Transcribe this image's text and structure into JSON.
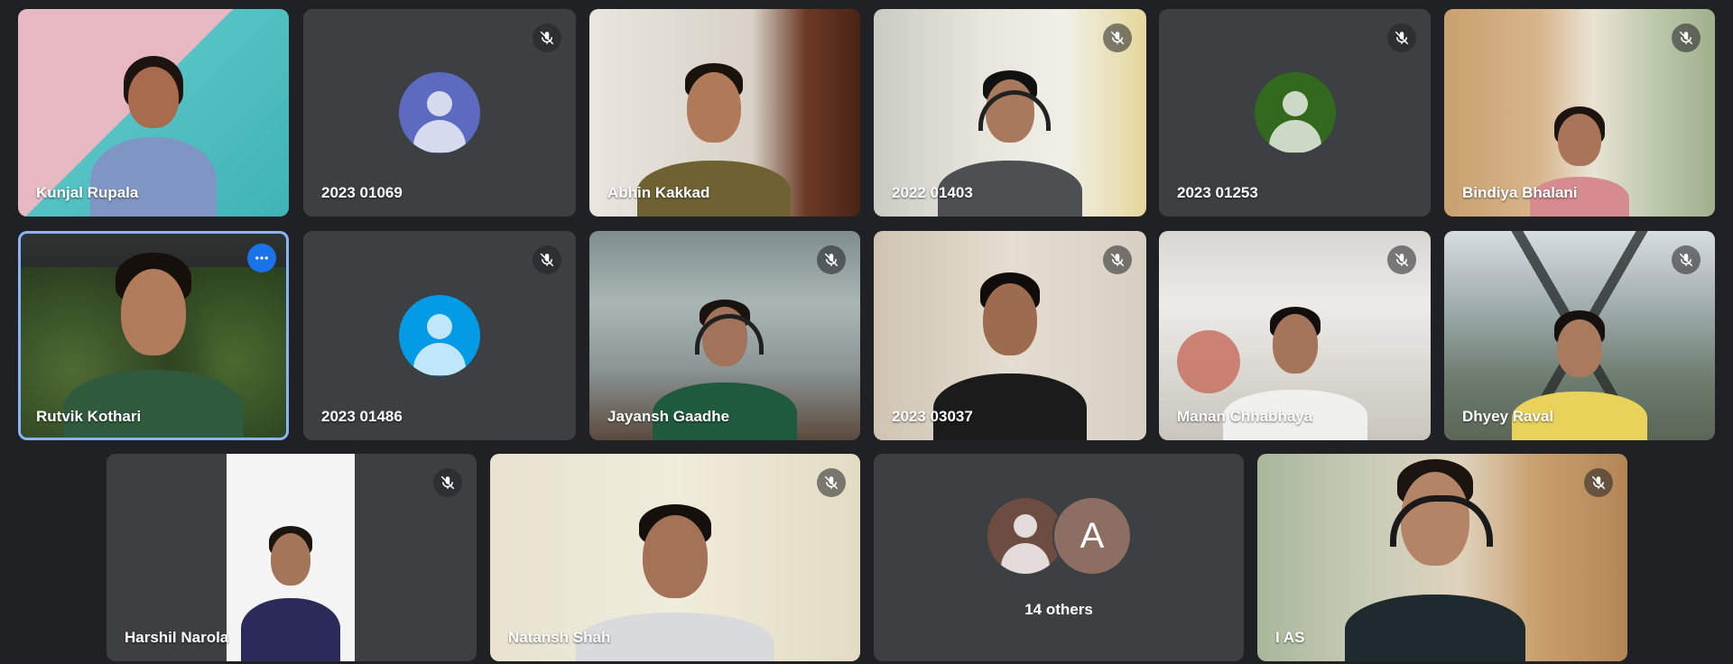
{
  "participants": {
    "t1": {
      "name": "Kunjal Rupala",
      "muted": false
    },
    "t2": {
      "name": "2023 01069",
      "muted": true,
      "avatar_color": "#5c6bc0"
    },
    "t3": {
      "name": "Abhin Kakkad",
      "muted": false
    },
    "t4": {
      "name": "2022 01403",
      "muted": true
    },
    "t5": {
      "name": "2023 01253",
      "muted": true,
      "avatar_color": "#33691e"
    },
    "t6": {
      "name": "Bindiya Bhalani",
      "muted": true
    },
    "t7": {
      "name": "Rutvik Kothari",
      "muted": false,
      "active_speaker": true
    },
    "t8": {
      "name": "2023 01486",
      "muted": true,
      "avatar_color": "#039be5"
    },
    "t9": {
      "name": "Jayansh Gaadhe",
      "muted": true
    },
    "t10": {
      "name": "2023 03037",
      "muted": true
    },
    "t11": {
      "name": "Manan Chhabhaya",
      "muted": true
    },
    "t12": {
      "name": "Dhyey Raval",
      "muted": true
    },
    "t13": {
      "name": "Harshil Narola",
      "muted": true
    },
    "t14": {
      "name": "Natansh Shah",
      "muted": true
    },
    "t15": {
      "name": "I AS",
      "muted": true
    }
  },
  "others": {
    "label": "14 others",
    "letter_avatar": "A",
    "avatar_colors": [
      "#6d4c41",
      "#8d6e63"
    ]
  },
  "icons": {
    "mute": "mic-off-icon",
    "more": "more-options-icon",
    "avatar": "person-avatar-icon"
  },
  "colors": {
    "background": "#202124",
    "tile": "#3c4043",
    "active_border": "#8ab4f8",
    "more_button": "#1a73e8"
  }
}
